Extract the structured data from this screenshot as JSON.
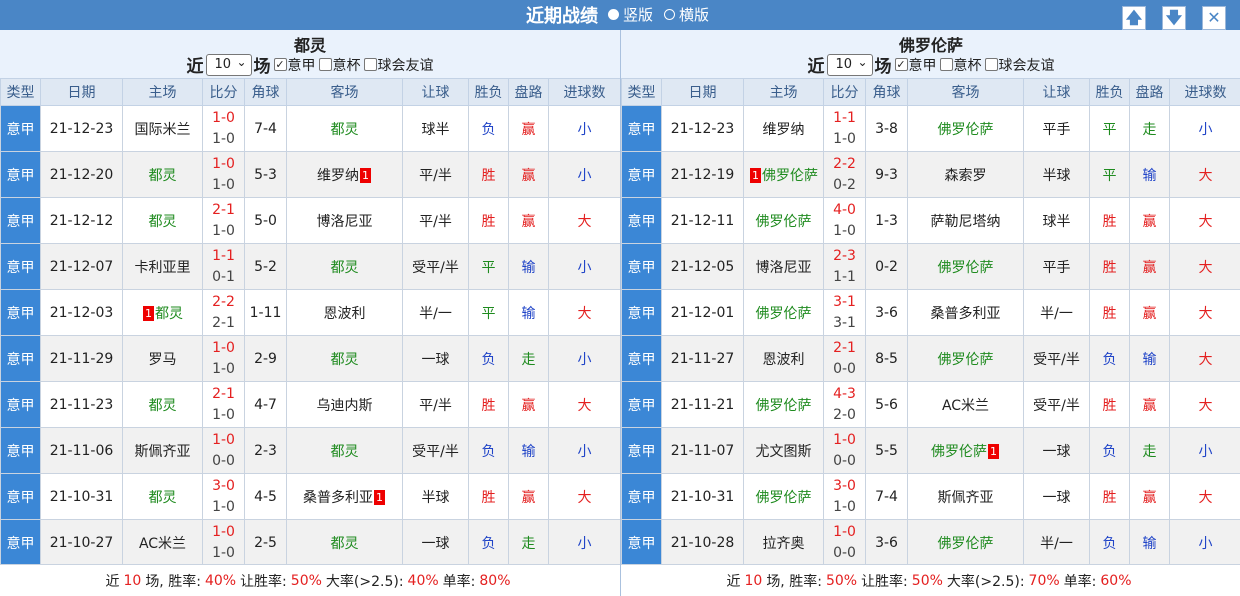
{
  "header": {
    "title": "近期战绩",
    "opt_vertical": "竖版",
    "opt_horizontal": "横版"
  },
  "buttons": {
    "up": "🡅",
    "down": "🡇",
    "close": "✕"
  },
  "columns": [
    "类型",
    "日期",
    "主场",
    "比分",
    "角球",
    "客场",
    "让球",
    "胜负",
    "盘路",
    "进球数"
  ],
  "colors": {
    "header_bar": "#4a86c6",
    "type_cell": "#3b87d6",
    "red": "#e42020",
    "green": "#1f8b1f",
    "blue": "#2145c8"
  },
  "panels": [
    {
      "team": "都灵",
      "near": "近",
      "count": "10",
      "chang": "场",
      "filters": [
        {
          "label": "意甲",
          "checked": true
        },
        {
          "label": "意杯",
          "checked": false
        },
        {
          "label": "球会友谊",
          "checked": false
        }
      ],
      "rows": [
        {
          "type": "意甲",
          "date": "21-12-23",
          "home": "国际米兰",
          "home_team": false,
          "ht": "1-0",
          "ft": "1-0",
          "corner": "7-4",
          "away": "都灵",
          "away_team": true,
          "hcp": "球半",
          "result": "负",
          "pan": "赢",
          "goals": "小"
        },
        {
          "type": "意甲",
          "date": "21-12-20",
          "home": "都灵",
          "home_team": true,
          "ht": "1-0",
          "ft": "1-0",
          "corner": "5-3",
          "away": "维罗纳",
          "away_team": false,
          "away_card": "1",
          "hcp": "平/半",
          "result": "胜",
          "pan": "赢",
          "goals": "小"
        },
        {
          "type": "意甲",
          "date": "21-12-12",
          "home": "都灵",
          "home_team": true,
          "ht": "2-1",
          "ft": "1-0",
          "corner": "5-0",
          "away": "博洛尼亚",
          "away_team": false,
          "hcp": "平/半",
          "result": "胜",
          "pan": "赢",
          "goals": "大"
        },
        {
          "type": "意甲",
          "date": "21-12-07",
          "home": "卡利亚里",
          "home_team": false,
          "ht": "1-1",
          "ft": "0-1",
          "corner": "5-2",
          "away": "都灵",
          "away_team": true,
          "hcp": "受平/半",
          "result": "平",
          "pan": "输",
          "goals": "小"
        },
        {
          "type": "意甲",
          "date": "21-12-03",
          "home": "都灵",
          "home_team": true,
          "home_card": "1",
          "ht": "2-2",
          "ft": "2-1",
          "corner": "1-11",
          "away": "恩波利",
          "away_team": false,
          "hcp": "半/一",
          "result": "平",
          "pan": "输",
          "goals": "大"
        },
        {
          "type": "意甲",
          "date": "21-11-29",
          "home": "罗马",
          "home_team": false,
          "ht": "1-0",
          "ft": "1-0",
          "corner": "2-9",
          "away": "都灵",
          "away_team": true,
          "hcp": "一球",
          "result": "负",
          "pan": "走",
          "goals": "小"
        },
        {
          "type": "意甲",
          "date": "21-11-23",
          "home": "都灵",
          "home_team": true,
          "ht": "2-1",
          "ft": "1-0",
          "corner": "4-7",
          "away": "乌迪内斯",
          "away_team": false,
          "hcp": "平/半",
          "result": "胜",
          "pan": "赢",
          "goals": "大"
        },
        {
          "type": "意甲",
          "date": "21-11-06",
          "home": "斯佩齐亚",
          "home_team": false,
          "ht": "1-0",
          "ft": "0-0",
          "corner": "2-3",
          "away": "都灵",
          "away_team": true,
          "hcp": "受平/半",
          "result": "负",
          "pan": "输",
          "goals": "小"
        },
        {
          "type": "意甲",
          "date": "21-10-31",
          "home": "都灵",
          "home_team": true,
          "ht": "3-0",
          "ft": "1-0",
          "corner": "4-5",
          "away": "桑普多利亚",
          "away_team": false,
          "away_card": "1",
          "hcp": "半球",
          "result": "胜",
          "pan": "赢",
          "goals": "大"
        },
        {
          "type": "意甲",
          "date": "21-10-27",
          "home": "AC米兰",
          "home_team": false,
          "ht": "1-0",
          "ft": "1-0",
          "corner": "2-5",
          "away": "都灵",
          "away_team": true,
          "hcp": "一球",
          "result": "负",
          "pan": "走",
          "goals": "小"
        }
      ],
      "summary": {
        "near": "近",
        "count": "10",
        "lbl_win": "场, 胜率:",
        "win": "40%",
        "lbl_rq": "让胜率:",
        "rq": "50%",
        "lbl_big": "大率(>2.5):",
        "big": "40%",
        "lbl_odd": "单率:",
        "odd": "80%"
      }
    },
    {
      "team": "佛罗伦萨",
      "near": "近",
      "count": "10",
      "chang": "场",
      "filters": [
        {
          "label": "意甲",
          "checked": true
        },
        {
          "label": "意杯",
          "checked": false
        },
        {
          "label": "球会友谊",
          "checked": false
        }
      ],
      "rows": [
        {
          "type": "意甲",
          "date": "21-12-23",
          "home": "维罗纳",
          "home_team": false,
          "ht": "1-1",
          "ft": "1-0",
          "corner": "3-8",
          "away": "佛罗伦萨",
          "away_team": true,
          "hcp": "平手",
          "result": "平",
          "pan": "走",
          "goals": "小"
        },
        {
          "type": "意甲",
          "date": "21-12-19",
          "home": "佛罗伦萨",
          "home_team": true,
          "home_card": "1",
          "ht": "2-2",
          "ft": "0-2",
          "corner": "9-3",
          "away": "森索罗",
          "away_team": false,
          "hcp": "半球",
          "result": "平",
          "pan": "输",
          "goals": "大"
        },
        {
          "type": "意甲",
          "date": "21-12-11",
          "home": "佛罗伦萨",
          "home_team": true,
          "ht": "4-0",
          "ft": "1-0",
          "corner": "1-3",
          "away": "萨勒尼塔纳",
          "away_team": false,
          "hcp": "球半",
          "result": "胜",
          "pan": "赢",
          "goals": "大"
        },
        {
          "type": "意甲",
          "date": "21-12-05",
          "home": "博洛尼亚",
          "home_team": false,
          "ht": "2-3",
          "ft": "1-1",
          "corner": "0-2",
          "away": "佛罗伦萨",
          "away_team": true,
          "hcp": "平手",
          "result": "胜",
          "pan": "赢",
          "goals": "大"
        },
        {
          "type": "意甲",
          "date": "21-12-01",
          "home": "佛罗伦萨",
          "home_team": true,
          "ht": "3-1",
          "ft": "3-1",
          "corner": "3-6",
          "away": "桑普多利亚",
          "away_team": false,
          "hcp": "半/一",
          "result": "胜",
          "pan": "赢",
          "goals": "大"
        },
        {
          "type": "意甲",
          "date": "21-11-27",
          "home": "恩波利",
          "home_team": false,
          "ht": "2-1",
          "ft": "0-0",
          "corner": "8-5",
          "away": "佛罗伦萨",
          "away_team": true,
          "hcp": "受平/半",
          "result": "负",
          "pan": "输",
          "goals": "大"
        },
        {
          "type": "意甲",
          "date": "21-11-21",
          "home": "佛罗伦萨",
          "home_team": true,
          "ht": "4-3",
          "ft": "2-0",
          "corner": "5-6",
          "away": "AC米兰",
          "away_team": false,
          "hcp": "受平/半",
          "result": "胜",
          "pan": "赢",
          "goals": "大"
        },
        {
          "type": "意甲",
          "date": "21-11-07",
          "home": "尤文图斯",
          "home_team": false,
          "ht": "1-0",
          "ft": "0-0",
          "corner": "5-5",
          "away": "佛罗伦萨",
          "away_team": true,
          "away_card": "1",
          "hcp": "一球",
          "result": "负",
          "pan": "走",
          "goals": "小"
        },
        {
          "type": "意甲",
          "date": "21-10-31",
          "home": "佛罗伦萨",
          "home_team": true,
          "ht": "3-0",
          "ft": "1-0",
          "corner": "7-4",
          "away": "斯佩齐亚",
          "away_team": false,
          "hcp": "一球",
          "result": "胜",
          "pan": "赢",
          "goals": "大"
        },
        {
          "type": "意甲",
          "date": "21-10-28",
          "home": "拉齐奥",
          "home_team": false,
          "ht": "1-0",
          "ft": "0-0",
          "corner": "3-6",
          "away": "佛罗伦萨",
          "away_team": true,
          "hcp": "半/一",
          "result": "负",
          "pan": "输",
          "goals": "小"
        }
      ],
      "summary": {
        "near": "近",
        "count": "10",
        "lbl_win": "场, 胜率:",
        "win": "50%",
        "lbl_rq": "让胜率:",
        "rq": "50%",
        "lbl_big": "大率(>2.5):",
        "big": "70%",
        "lbl_odd": "单率:",
        "odd": "60%"
      }
    }
  ]
}
